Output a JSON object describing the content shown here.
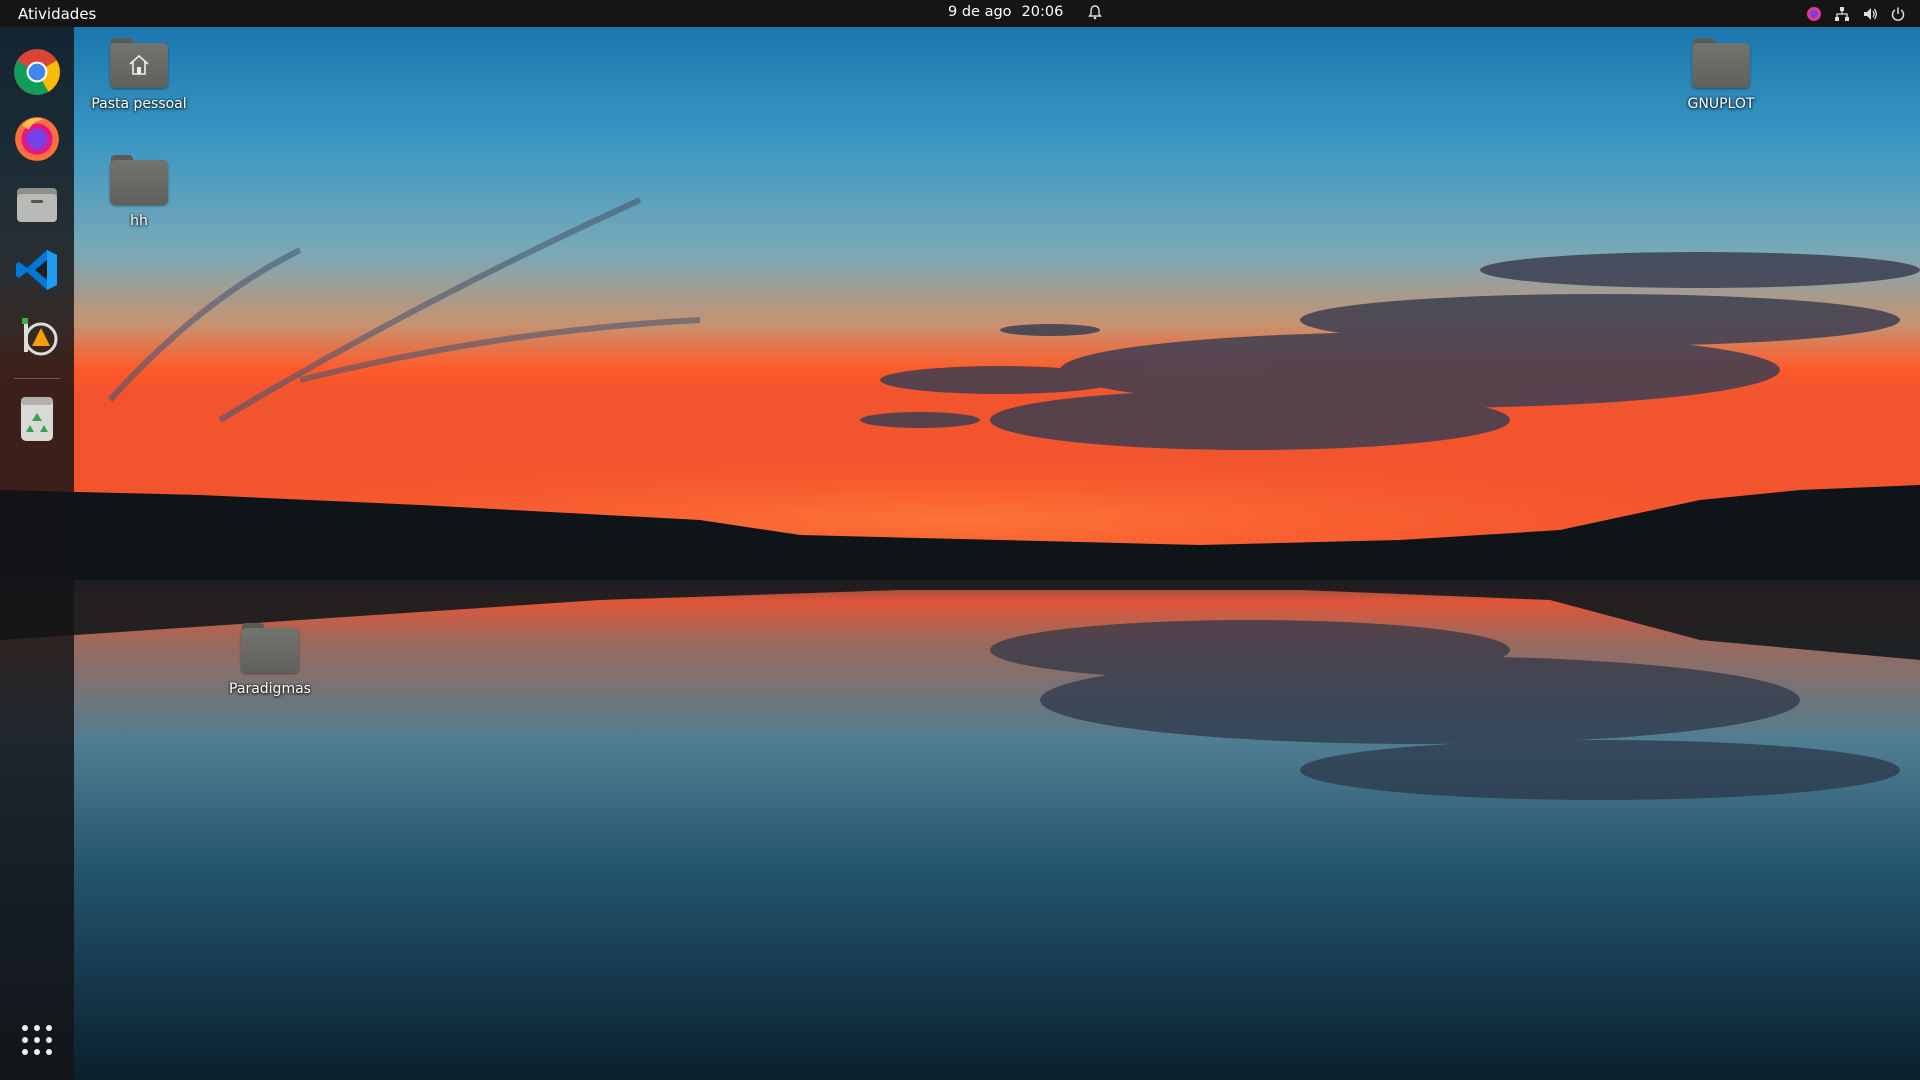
{
  "topbar": {
    "activities_label": "Atividades",
    "date": "9 de ago",
    "time": "20:06",
    "icons": [
      "notification-bell-icon",
      "firefox-indicator-icon",
      "network-icon",
      "volume-icon",
      "power-icon"
    ]
  },
  "dock": {
    "apps": [
      {
        "name": "Google Chrome",
        "icon": "chrome-icon"
      },
      {
        "name": "Firefox",
        "icon": "firefox-icon"
      },
      {
        "name": "Arquivos",
        "icon": "files-icon"
      },
      {
        "name": "Visual Studio Code",
        "icon": "vscode-icon"
      },
      {
        "name": "Inkscape",
        "icon": "inkscape-icon"
      },
      {
        "name": "Lixeira",
        "icon": "trash-icon"
      }
    ],
    "show_apps_icon": "app-grid-icon"
  },
  "desktop": {
    "icons": [
      {
        "label": "Pasta pessoal",
        "icon": "home-folder-icon"
      },
      {
        "label": "hh",
        "icon": "folder-icon"
      },
      {
        "label": "Paradigmas",
        "icon": "folder-icon"
      },
      {
        "label": "GNUPLOT",
        "icon": "folder-icon"
      }
    ]
  },
  "colors": {
    "topbar_bg": "#151515",
    "dock_bg": "#141416",
    "sky_top": "#1f6fa0",
    "sunset_orange": "#ff5a2a",
    "water_dark": "#0d2636"
  }
}
